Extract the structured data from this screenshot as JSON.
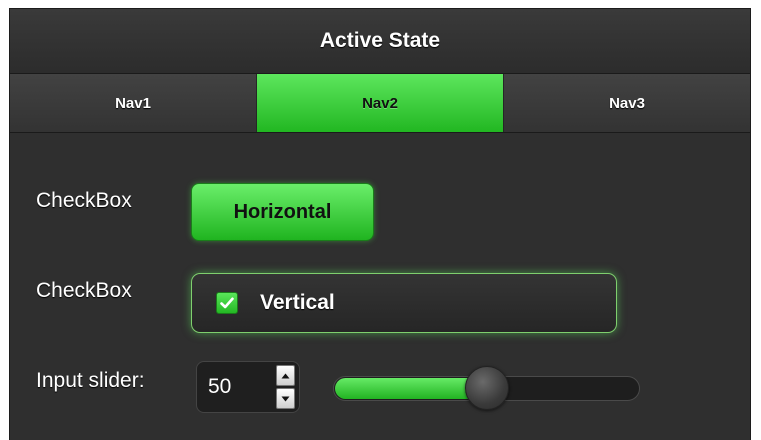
{
  "header": {
    "title": "Active State"
  },
  "nav": {
    "items": [
      {
        "label": "Nav1",
        "active": false
      },
      {
        "label": "Nav2",
        "active": true
      },
      {
        "label": "Nav3",
        "active": false
      }
    ]
  },
  "form": {
    "row1": {
      "label": "CheckBox",
      "button_label": "Horizontal"
    },
    "row2": {
      "label": "CheckBox",
      "checkbox_label": "Vertical",
      "checked": true
    },
    "row3": {
      "label": "Input slider:",
      "value": "50",
      "slider_percent": 50
    }
  },
  "colors": {
    "accent": "#2ecc2e",
    "background": "#2f2f2f",
    "header": "#333333"
  },
  "icons": {
    "checkbox": "checkmark-icon",
    "spinner_up": "arrow-up-icon",
    "spinner_down": "arrow-down-icon"
  }
}
